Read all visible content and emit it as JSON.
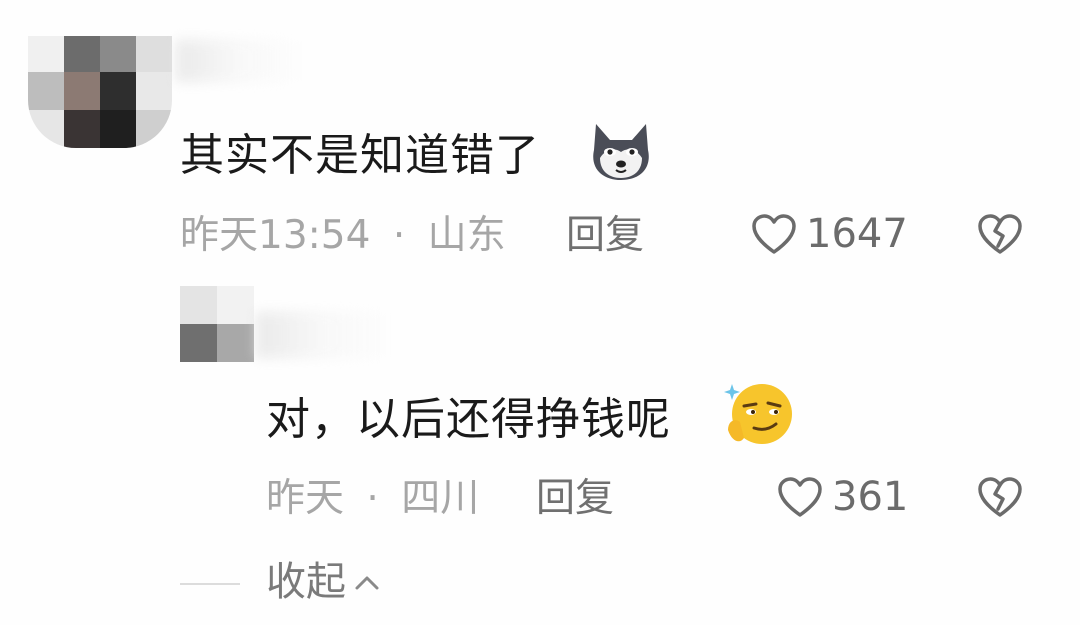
{
  "comments": [
    {
      "text": "其实不是知道错了",
      "emoji": "dog-head-emoji",
      "time": "昨天13:54",
      "separator": "·",
      "location": "山东",
      "reply_label": "回复",
      "likes": "1647"
    },
    {
      "text": "对，以后还得挣钱呢",
      "emoji": "smirk-thinking-emoji",
      "time": "昨天",
      "separator": "·",
      "location": "四川",
      "reply_label": "回复",
      "likes": "361"
    }
  ],
  "collapse_label": "收起",
  "colors": {
    "text": "#1a1a1a",
    "meta": "#a6a6a6",
    "action": "#6b6b6b",
    "background": "#fefefe"
  },
  "icons": [
    "heart-outline-icon",
    "broken-heart-icon",
    "chevron-up-icon"
  ]
}
